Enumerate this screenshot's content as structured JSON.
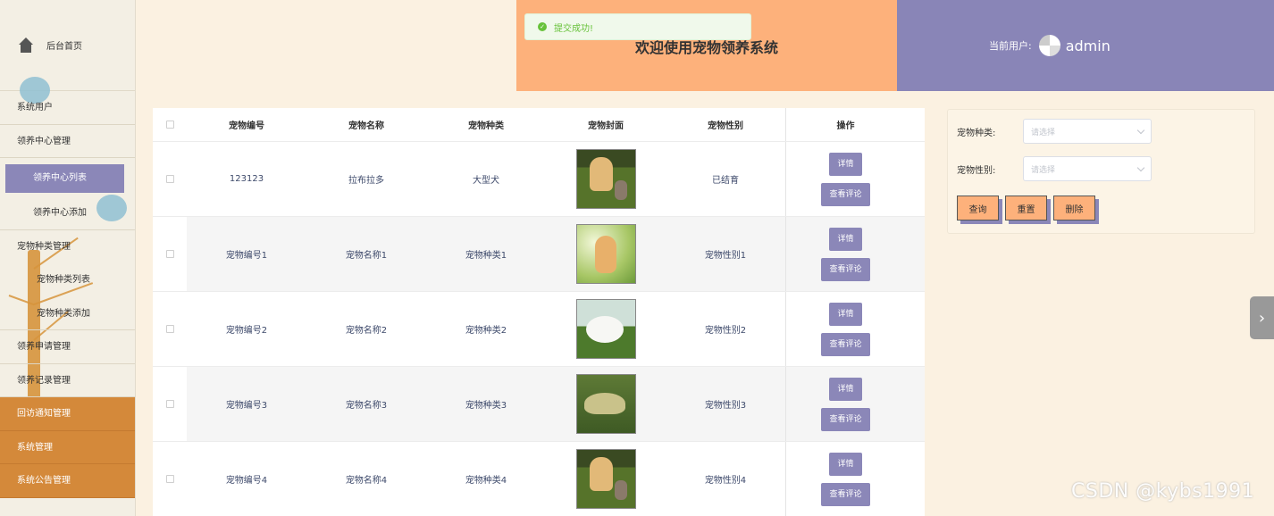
{
  "sidebar": {
    "home_label": "后台首页",
    "items": [
      {
        "label": "系统用户"
      },
      {
        "label": "领养中心管理"
      },
      {
        "label": "领养中心列表"
      },
      {
        "label": "领养中心添加"
      },
      {
        "label": "宠物种类管理"
      },
      {
        "label": "宠物种类列表"
      },
      {
        "label": "宠物种类添加"
      },
      {
        "label": "领养申请管理"
      },
      {
        "label": "领养记录管理"
      },
      {
        "label": "回访通知管理"
      },
      {
        "label": "系统管理"
      },
      {
        "label": "系统公告管理"
      }
    ]
  },
  "header": {
    "title": "欢迎使用宠物领养系统",
    "user_label": "当前用户:",
    "username": "admin"
  },
  "toast": {
    "message": "提交成功!"
  },
  "table": {
    "columns": [
      "宠物编号",
      "宠物名称",
      "宠物种类",
      "宠物封面",
      "宠物性别",
      "操作"
    ],
    "rows": [
      {
        "code": "123123",
        "name": "拉布拉多",
        "kind": "大型犬",
        "gender": "已结育",
        "image": "dog-and-cat"
      },
      {
        "code": "宠物编号1",
        "name": "宠物名称1",
        "kind": "宠物种类1",
        "gender": "宠物性别1",
        "image": "kitten"
      },
      {
        "code": "宠物编号2",
        "name": "宠物名称2",
        "kind": "宠物种类2",
        "gender": "宠物性别2",
        "image": "rabbit"
      },
      {
        "code": "宠物编号3",
        "name": "宠物名称3",
        "kind": "宠物种类3",
        "gender": "宠物性别3",
        "image": "turtle"
      },
      {
        "code": "宠物编号4",
        "name": "宠物名称4",
        "kind": "宠物种类4",
        "gender": "宠物性别4",
        "image": "dog-and-cat"
      }
    ],
    "detail_label": "详情",
    "comments_label": "查看评论"
  },
  "search": {
    "kind_label": "宠物种类:",
    "kind_placeholder": "请选择",
    "gender_label": "宠物性别:",
    "gender_placeholder": "请选择",
    "query_label": "查询",
    "reset_label": "重置",
    "delete_label": "删除"
  },
  "watermark": "CSDN @kybs1991",
  "colors": {
    "accent_purple": "#8b87b8",
    "accent_orange": "#fdb17b",
    "sidebar_orange": "#d4893a",
    "background": "#fbf1e1"
  }
}
